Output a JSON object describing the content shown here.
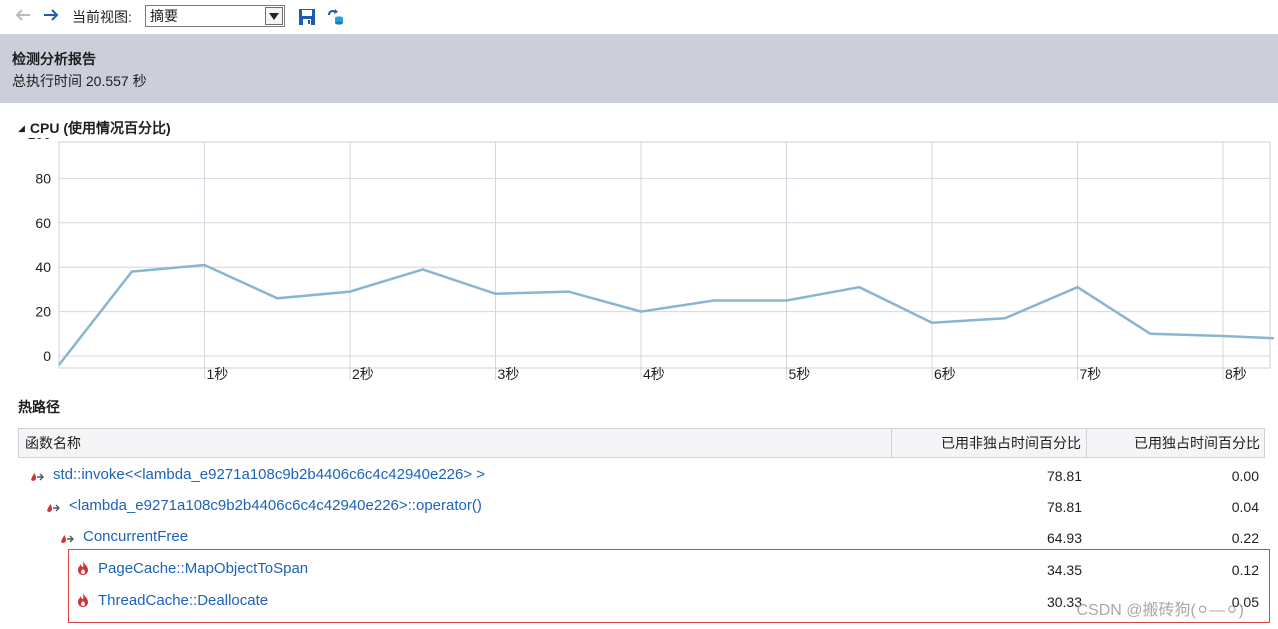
{
  "toolbar": {
    "back_icon": "arrow-left-icon",
    "forward_icon": "arrow-right-icon",
    "view_label": "当前视图:",
    "view_select_value": "摘要",
    "save_icon": "save-icon",
    "export_icon": "export-icon"
  },
  "report": {
    "title": "检测分析报告",
    "total_time": "总执行时间 20.557 秒"
  },
  "cpu": {
    "title": "CPU (使用情况百分比)"
  },
  "chart_data": {
    "type": "line",
    "title": "CPU (使用情况百分比)",
    "xlabel": "",
    "ylabel": "",
    "ylim": [
      0,
      100
    ],
    "yticks": [
      "100",
      "80",
      "60",
      "40",
      "20",
      "0"
    ],
    "xticks": [
      "1秒",
      "2秒",
      "3秒",
      "4秒",
      "5秒",
      "6秒",
      "7秒",
      "8秒"
    ],
    "grid": true,
    "color": "#88b6d1",
    "points": [
      {
        "x": 0.0,
        "y": -4
      },
      {
        "x": 0.5,
        "y": 38
      },
      {
        "x": 1.0,
        "y": 41
      },
      {
        "x": 1.5,
        "y": 26
      },
      {
        "x": 2.0,
        "y": 29
      },
      {
        "x": 2.5,
        "y": 39
      },
      {
        "x": 3.0,
        "y": 28
      },
      {
        "x": 3.5,
        "y": 29
      },
      {
        "x": 4.0,
        "y": 20
      },
      {
        "x": 4.5,
        "y": 25
      },
      {
        "x": 5.0,
        "y": 25
      },
      {
        "x": 5.5,
        "y": 31
      },
      {
        "x": 6.0,
        "y": 15
      },
      {
        "x": 6.5,
        "y": 17
      },
      {
        "x": 7.0,
        "y": 31
      },
      {
        "x": 7.5,
        "y": 10
      },
      {
        "x": 8.0,
        "y": 9
      },
      {
        "x": 8.35,
        "y": 8
      }
    ]
  },
  "hotpath": {
    "title": "热路径",
    "columns": [
      "函数名称",
      "已用非独占时间百分比",
      "已用独占时间百分比"
    ],
    "rows": [
      {
        "name": "std::invoke<<lambda_e9271a108c9b2b4406c6c4c42940e226> >",
        "inclusive": "78.81",
        "exclusive": "0.00",
        "icon": "hot-path-icon"
      },
      {
        "name": "<lambda_e9271a108c9b2b4406c6c4c42940e226>::operator()",
        "inclusive": "78.81",
        "exclusive": "0.04",
        "icon": "hot-path-icon"
      },
      {
        "name": "ConcurrentFree",
        "inclusive": "64.93",
        "exclusive": "0.22",
        "icon": "hot-path-icon"
      },
      {
        "name": "PageCache::MapObjectToSpan",
        "inclusive": "34.35",
        "exclusive": "0.12",
        "icon": "flame-icon"
      },
      {
        "name": "ThreadCache::Deallocate",
        "inclusive": "30.33",
        "exclusive": "0.05",
        "icon": "flame-icon"
      }
    ]
  },
  "watermark": "CSDN @搬砖狗(⚪︎—⚪︎)"
}
